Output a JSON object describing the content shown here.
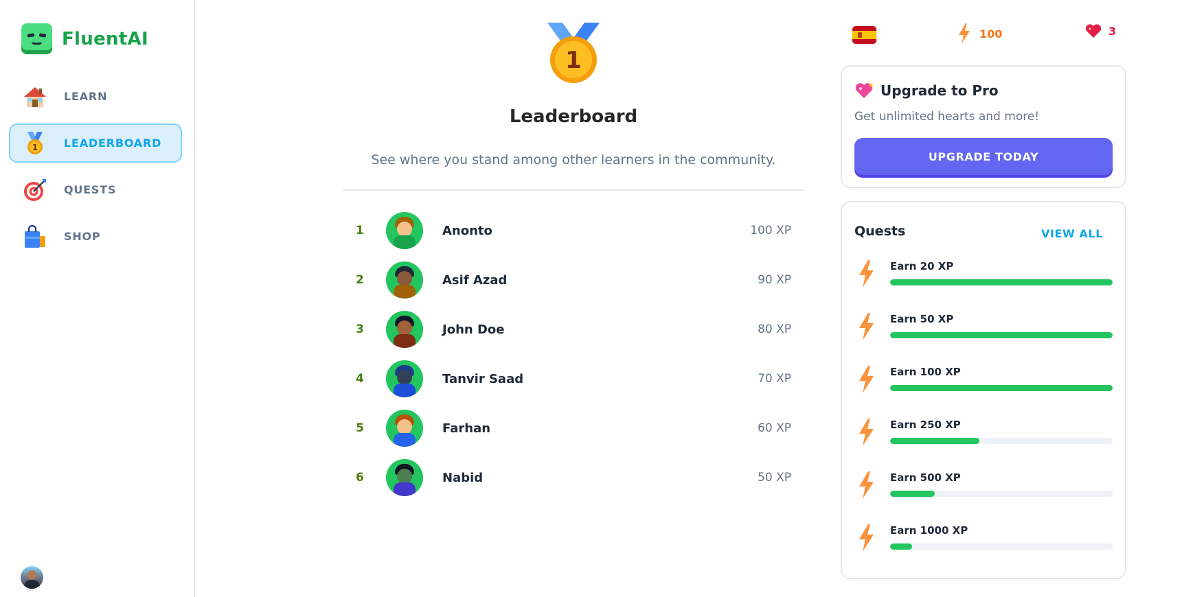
{
  "app": {
    "name": "FluentAI"
  },
  "sidebar": {
    "items": [
      {
        "label": "LEARN",
        "icon": "house-icon",
        "active": false
      },
      {
        "label": "LEADERBOARD",
        "icon": "medal-icon",
        "active": true
      },
      {
        "label": "QUESTS",
        "icon": "target-icon",
        "active": false
      },
      {
        "label": "SHOP",
        "icon": "shopping-bag-icon",
        "active": false
      }
    ]
  },
  "header": {
    "medal_number": "1",
    "title": "Leaderboard",
    "subtitle": "See where you stand among other learners in the community."
  },
  "leaderboard": [
    {
      "rank": "1",
      "name": "Anonto",
      "xp": "100 XP"
    },
    {
      "rank": "2",
      "name": "Asif Azad",
      "xp": "90 XP"
    },
    {
      "rank": "3",
      "name": "John Doe",
      "xp": "80 XP"
    },
    {
      "rank": "4",
      "name": "Tanvir Saad",
      "xp": "70 XP"
    },
    {
      "rank": "5",
      "name": "Farhan",
      "xp": "60 XP"
    },
    {
      "rank": "6",
      "name": "Nabid",
      "xp": "50 XP"
    }
  ],
  "stats": {
    "language": "Spanish",
    "language_flag": "spain-flag-icon",
    "points": "100",
    "hearts": "3"
  },
  "promo": {
    "title": "Upgrade to Pro",
    "subtitle": "Get unlimited hearts and more!",
    "button_label": "UPGRADE TODAY"
  },
  "quests": {
    "title": "Quests",
    "view_all_label": "VIEW ALL",
    "items": [
      {
        "label": "Earn 20 XP",
        "progress": 1.0
      },
      {
        "label": "Earn 50 XP",
        "progress": 1.0
      },
      {
        "label": "Earn 100 XP",
        "progress": 1.0
      },
      {
        "label": "Earn 250 XP",
        "progress": 0.4
      },
      {
        "label": "Earn 500 XP",
        "progress": 0.2
      },
      {
        "label": "Earn 1000 XP",
        "progress": 0.1
      }
    ]
  },
  "colors": {
    "brand": "#16a34a",
    "accent": "#0ea5e9",
    "primary_button": "#6366f1",
    "progress": "#22c55e",
    "streak": "#f97316",
    "hearts": "#e11d48"
  }
}
